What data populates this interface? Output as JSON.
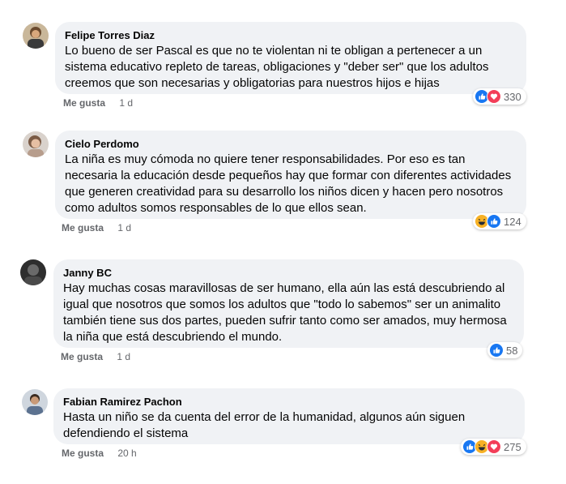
{
  "comments": [
    {
      "author": "Felipe Torres Diaz",
      "text": "Lo bueno de ser Pascal es que no te violentan ni te obligan a pertenecer a un sistema educativo repleto de tareas, obligaciones y \"deber ser\" que los adultos creemos que son necesarias y obligatorias para nuestros hijos e hijas",
      "like_label": "Me gusta",
      "time": "1 d",
      "reaction_count": "330",
      "reactions": [
        "like-icon",
        "love-icon"
      ]
    },
    {
      "author": "Cielo Perdomo",
      "text": "La niña es muy cómoda no quiere tener responsabilidades. Por eso es tan necesaria la educación desde pequeños hay que formar con diferentes actividades que generen creatividad para su desarrollo los niños dicen y hacen pero nosotros como adultos somos responsables de lo que ellos sean.",
      "like_label": "Me gusta",
      "time": "1 d",
      "reaction_count": "124",
      "reactions": [
        "haha-icon",
        "like-icon"
      ]
    },
    {
      "author": "Janny BC",
      "text": "Hay muchas cosas maravillosas de ser humano, ella aún las está descubriendo al igual que nosotros que somos los adultos que \"todo lo sabemos\" ser un animalito también tiene sus dos partes, pueden sufrir tanto como ser amados, muy hermosa la niña que está descubriendo el mundo.",
      "like_label": "Me gusta",
      "time": "1 d",
      "reaction_count": "58",
      "reactions": [
        "like-icon"
      ]
    },
    {
      "author": "Fabian Ramirez Pachon",
      "text": "Hasta un niño se da cuenta del error de la humanidad, algunos aún siguen defendiendo el sistema",
      "like_label": "Me gusta",
      "time": "20 h",
      "reaction_count": "275",
      "reactions": [
        "like-icon",
        "haha-icon",
        "love-icon"
      ]
    }
  ],
  "colors": {
    "bubble": "#f0f2f5",
    "like": "#1877f2",
    "love": "#f33e58",
    "haha": "#f7b125",
    "meta": "#65676b"
  }
}
